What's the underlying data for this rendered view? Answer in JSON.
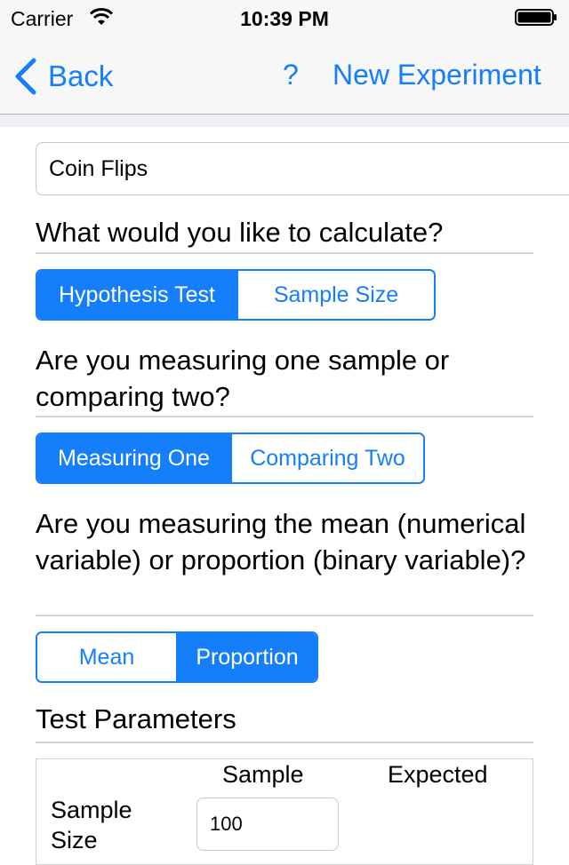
{
  "status_bar": {
    "carrier": "Carrier",
    "time": "10:39 PM"
  },
  "nav": {
    "back_label": "Back",
    "help_label": "?",
    "new_experiment_label": "New Experiment"
  },
  "form": {
    "experiment_name": "Coin Flips",
    "q_calculate": "What would you like to calculate?",
    "calc_options": [
      "Hypothesis Test",
      "Sample Size"
    ],
    "calc_selected": "Hypothesis Test",
    "q_samples": "Are you measuring one sample or comparing two?",
    "sample_options": [
      "Measuring One",
      "Comparing Two"
    ],
    "sample_selected": "Measuring One",
    "q_measure": "Are you measuring the mean (numerical variable) or proportion (binary variable)?",
    "measure_options": [
      "Mean",
      "Proportion"
    ],
    "measure_selected": "Proportion"
  },
  "params": {
    "heading": "Test Parameters",
    "col_sample": "Sample",
    "col_expected": "Expected",
    "row_sample_size_label": "Sample Size",
    "sample_size_value": "100"
  },
  "colors": {
    "accent": "#147efb",
    "nav_bg": "#f7f7f7",
    "rule": "#d4d4d4"
  }
}
